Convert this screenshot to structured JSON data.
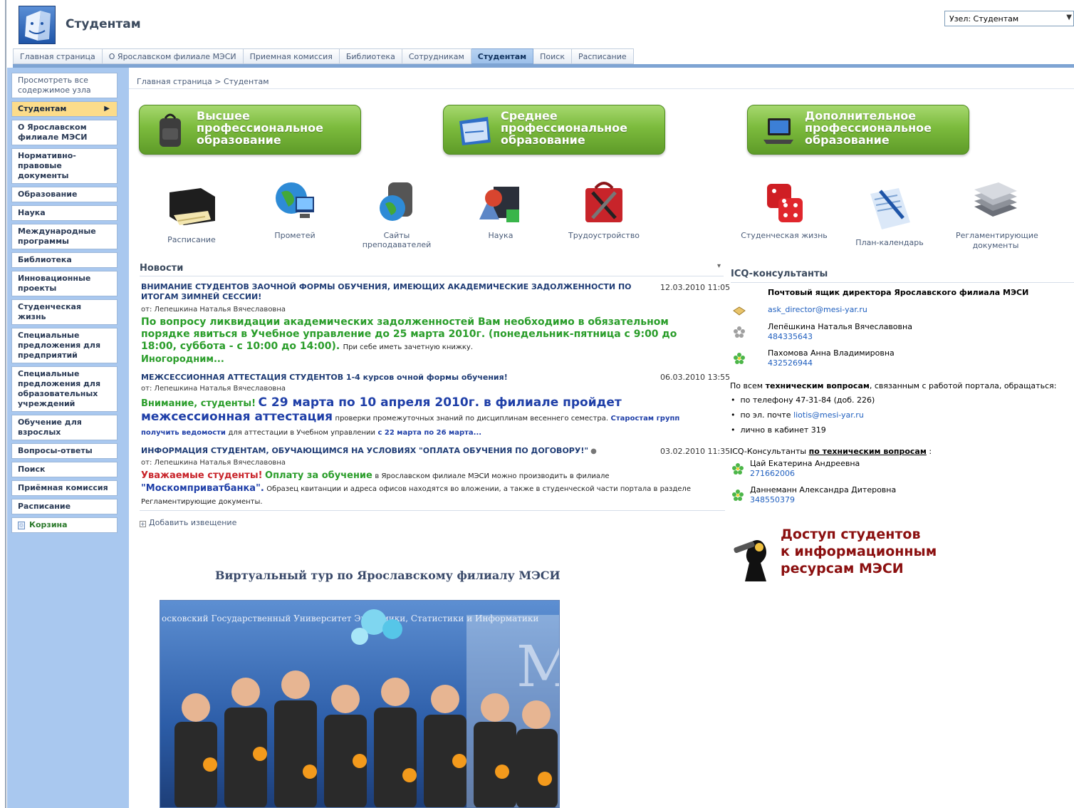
{
  "header": {
    "site_title": "Студентам",
    "site_select": "Узел: Студентам"
  },
  "tabs": [
    "Главная страница",
    "О Ярославском филиале МЭСИ",
    "Приемная комиссия",
    "Библиотека",
    "Сотрудникам",
    "Студентам",
    "Поиск",
    "Расписание"
  ],
  "sidebar": {
    "view_all": "Просмотреть все содержимое узла",
    "items": [
      "Студентам",
      "О Ярославском филиале МЭСИ",
      "Нормативно-правовые документы",
      "Образование",
      "Наука",
      "Международные программы",
      "Библиотека",
      "Инновационные проекты",
      "Студенческая жизнь",
      "Специальные предложения для предприятий",
      "Специальные предложения для образовательных учреждений",
      "Обучение для взрослых",
      "Вопросы-ответы",
      "Поиск",
      "Приёмная комиссия",
      "Расписание"
    ],
    "cart": "Корзина"
  },
  "breadcrumb": "Главная страница > Студентам",
  "big_buttons": [
    [
      "Высшее",
      "профессиональное",
      "образование"
    ],
    [
      "Среднее",
      "профессиональное",
      "образование"
    ],
    [
      "Дополнительное",
      "профессиональное",
      "образование"
    ]
  ],
  "tiles": [
    "Расписание",
    "Прометей",
    "Сайты преподавателей",
    "Наука",
    "Трудоустройство",
    "Студенческая жизнь",
    "План-календарь",
    "Регламентирующие документы"
  ],
  "news": {
    "header": "Новости",
    "items": [
      {
        "title": "ВНИМАНИЕ СТУДЕНТОВ ЗАОЧНОЙ ФОРМЫ ОБУЧЕНИЯ, ИМЕЮЩИХ АКАДЕМИЧЕСКИЕ ЗАДОЛЖЕННОСТИ ПО ИТОГАМ ЗИМНЕЙ СЕССИИ!",
        "date": "12.03.2010 11:05",
        "from": "от: Лепешкина Наталья Вячеславовна",
        "body1": "По вопросу ликвидации академических задолженностей Вам необходимо в обязательном порядке явиться в Учебное управление до 25 марта 2010г. (понедельник-пятница с 9:00 до 18:00, суббота - с 10:00 до 14:00).",
        "body1_small": "При себе иметь зачетную книжку.",
        "body2": "Иногородним..."
      },
      {
        "title": "МЕЖСЕССИОННАЯ АТТЕСТАЦИЯ СТУДЕНТОВ 1-4 курсов очной формы обучения!",
        "date": "06.03.2010 13:55",
        "from": "от: Лепешкина Наталья Вячеславовна",
        "lead": "Внимание, студенты!",
        "big": "С 29 марта по 10 апреля 2010г. в филиале пройдет межсессионная аттестация",
        "small1": "проверки промежуточных знаний по дисциплинам весеннего семестра.",
        "bold1": "Старостам групп получить ведомости",
        "small2": "для аттестации в Учебном управлении",
        "bold2": "с 22 марта по 26 марта..."
      },
      {
        "title": "ИНФОРМАЦИЯ СТУДЕНТАМ, ОБУЧАЮЩИМСЯ НА УСЛОВИЯХ \"ОПЛАТА ОБУЧЕНИЯ ПО ДОГОВОРУ!\"",
        "date": "03.02.2010 11:35",
        "from": "от: Лепешкина Наталья Вячеславовна",
        "lead": "Уважаемые студенты!",
        "green2": "Оплату за обучение",
        "small1": "в Ярославском филиале МЭСИ можно производить в филиале",
        "bank": "\"Москомприватбанка\".",
        "small2": "Образец квитанции и адреса офисов находятся во вложении, а также в студенческой части портала в разделе Регламентирующие документы."
      }
    ],
    "add": "Добавить извещение"
  },
  "tour": {
    "title": "Виртуальный тур по Ярославскому филиалу МЭСИ",
    "banner": "осковский Государственный Университет Экономики, Статистики и Информатики"
  },
  "icq": {
    "header": "ICQ-консультанты",
    "director_title": "Почтовый ящик директора Ярославского филиала МЭСИ",
    "director_email": "ask_director@mesi-yar.ru",
    "c1_name": "Лепёшкина Наталья Вячеславовна",
    "c1_num": "484335643",
    "c2_name": "Пахомова Анна Владимировна",
    "c2_num": "432526944",
    "tech_line_a": "По всем",
    "tech_line_b": "техническим вопросам",
    "tech_line_c": ", связанным с работой портала, обращаться:",
    "bullets": [
      "по телефону 47-31-84 (доб. 226)",
      "по эл. почте",
      "лично в кабинет 319"
    ],
    "email2": "liotis@mesi-yar.ru",
    "tech_icq_a": "ICQ-Консультанты",
    "tech_icq_b": "по техническим вопросам",
    "tech_icq_c": ":",
    "t1_name": "Цай Екатерина Андреевна",
    "t1_num": "271662006",
    "t2_name": "Даннеманн Александра Дитеровна",
    "t2_num": "348550379"
  },
  "access": [
    "Доступ студентов",
    "к информационным",
    "ресурсам МЭСИ"
  ],
  "colors": {
    "accent": "#7ea4d3",
    "sidebar_bg": "#a9c8ef",
    "green": "#2a9d2a",
    "news_blue": "#1f3c75",
    "access_red": "#8b0f0f"
  }
}
